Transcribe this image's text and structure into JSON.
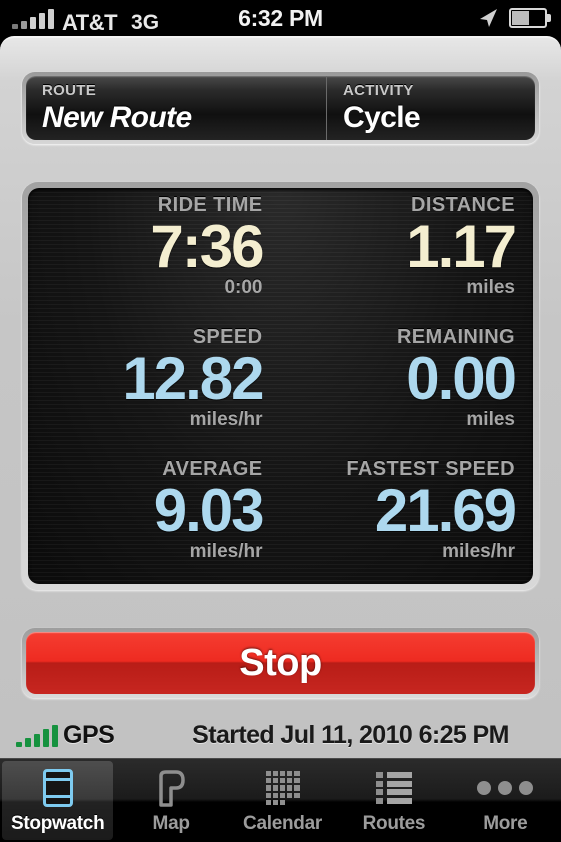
{
  "status_bar": {
    "carrier": "AT&T",
    "network": "3G",
    "clock": "6:32 PM",
    "signal_bars": 5,
    "battery_percent": 50,
    "location_icon": "location-arrow-icon",
    "battery_icon": "battery-icon"
  },
  "header": {
    "route_label": "ROUTE",
    "route_value": "New Route",
    "activity_label": "ACTIVITY",
    "activity_value": "Cycle"
  },
  "stats": [
    {
      "label": "RIDE TIME",
      "value": "7:36",
      "unit": "0:00",
      "color": "#f4eed0",
      "tone": "cream"
    },
    {
      "label": "DISTANCE",
      "value": "1.17",
      "unit": "miles",
      "color": "#f4eed0",
      "tone": "cream"
    },
    {
      "label": "SPEED",
      "value": "12.82",
      "unit": "miles/hr",
      "color": "#add8ee",
      "tone": "blue"
    },
    {
      "label": "REMAINING",
      "value": "0.00",
      "unit": "miles",
      "color": "#add8ee",
      "tone": "blue"
    },
    {
      "label": "AVERAGE",
      "value": "9.03",
      "unit": "miles/hr",
      "color": "#add8ee",
      "tone": "blue"
    },
    {
      "label": "FASTEST SPEED",
      "value": "21.69",
      "unit": "miles/hr",
      "color": "#add8ee",
      "tone": "blue"
    }
  ],
  "action": {
    "stop_label": "Stop",
    "stop_color": "#e02a20"
  },
  "footer": {
    "gps_label": "GPS",
    "gps_bars": 5,
    "gps_color": "#16923f",
    "started_text": "Started Jul 11, 2010 6:25 PM"
  },
  "tabs": [
    {
      "label": "Stopwatch",
      "icon": "stopwatch-icon",
      "active": true,
      "accent": "#7ecbf0"
    },
    {
      "label": "Map",
      "icon": "map-pin-icon",
      "active": false
    },
    {
      "label": "Calendar",
      "icon": "calendar-grid-icon",
      "active": false
    },
    {
      "label": "Routes",
      "icon": "list-icon",
      "active": false
    },
    {
      "label": "More",
      "icon": "ellipsis-icon",
      "active": false
    }
  ]
}
